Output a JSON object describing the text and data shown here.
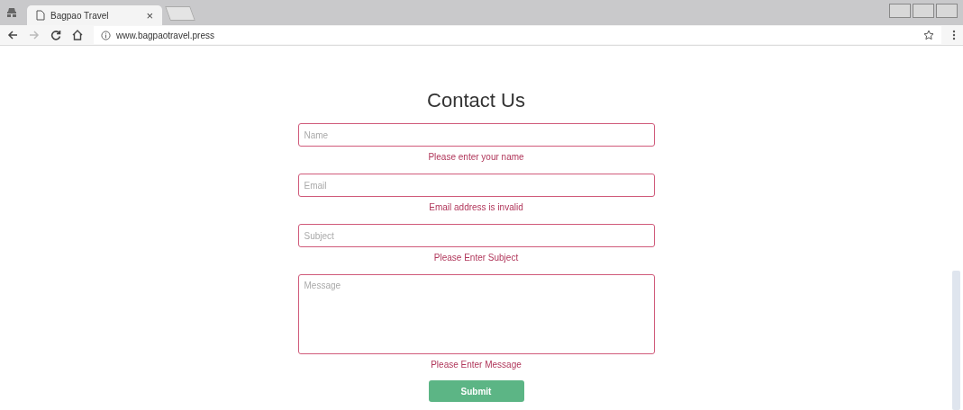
{
  "browser": {
    "tab_title": "Bagpao Travel",
    "tab_close": "×",
    "url": "www.bagpaotravel.press"
  },
  "page": {
    "title": "Contact Us",
    "fields": [
      {
        "kind": "input",
        "placeholder": "Name",
        "invalid": true,
        "error": "Please enter your name"
      },
      {
        "kind": "input",
        "placeholder": "Email",
        "invalid": true,
        "error": "Email address is invalid"
      },
      {
        "kind": "input",
        "placeholder": "Subject",
        "invalid": true,
        "error": "Please Enter Subject"
      },
      {
        "kind": "textarea",
        "placeholder": "Message",
        "invalid": true,
        "error": "Please Enter Message"
      }
    ],
    "submit": "Submit"
  }
}
